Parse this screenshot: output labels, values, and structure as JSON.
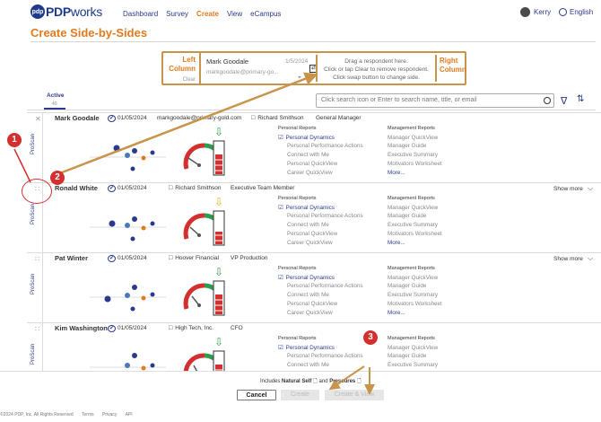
{
  "nav": {
    "logo_mark": "pdp",
    "logo_bold": "PDP",
    "logo_light": "works",
    "links": [
      "Dashboard",
      "Survey",
      "Create",
      "View",
      "eCampus"
    ],
    "active_link": "Create",
    "user": "Kerry",
    "language": "English"
  },
  "page": {
    "title": "Create Side-by-Sides"
  },
  "compare": {
    "left_label_1": "Left",
    "left_label_2": "Column",
    "left_clear": "Clear",
    "left_name": "Mark Goodale",
    "left_date": "1/5/2024",
    "left_email": "markgoodale@primary-go...",
    "mid_line1": "Drag a respondent here.",
    "mid_line2": "Click or tap Clear to remove respondent.",
    "mid_line3": "Click swap button to change side.",
    "right_label_1": "Right",
    "right_label_2": "Column"
  },
  "tabs": {
    "active_label": "Active",
    "active_count": "40"
  },
  "search": {
    "placeholder": "Click search icon or Enter to search name, title, or email"
  },
  "rows": [
    {
      "name": "Mark Goodale",
      "date": "01/05/2024",
      "email": "markgoodale@primary-gold.com",
      "company": "Richard Smithson",
      "title": "General Manager",
      "show_more": "",
      "side": "ProScan"
    },
    {
      "name": "Ronald White",
      "date": "01/05/2024",
      "email": "",
      "company": "Richard Smithson",
      "title": "Executive Team Member",
      "show_more": "Show more",
      "side": "ProScan"
    },
    {
      "name": "Pat Winter",
      "date": "01/05/2024",
      "email": "",
      "company": "Hoover Financial",
      "title": "VP Production",
      "show_more": "Show more",
      "side": "ProScan"
    },
    {
      "name": "Kim Washington",
      "date": "01/05/2024",
      "email": "",
      "company": "High Tech, Inc.",
      "title": "CFO",
      "show_more": "",
      "side": "ProScan"
    }
  ],
  "reports": {
    "personal_header": "Personal Reports",
    "personal": [
      "Personal Dynamics",
      "Personal Performance Actions",
      "Connect with Me",
      "Personal QuickView",
      "Career QuickView"
    ],
    "management_header": "Management Reports",
    "management": [
      "Manager QuickView",
      "Manager Guide",
      "Executive Summary",
      "Motivators Worksheet"
    ],
    "more": "More..."
  },
  "footer": {
    "includes_prefix": "Includes",
    "natural_self": "Natural Self",
    "and_text": "and",
    "pressures": "Pressures",
    "cancel": "Cancel",
    "create": "Create",
    "create_view": "Create & View",
    "copyright": "©2024 PDP, Inc. All Rights Reserved",
    "terms": "Terms",
    "privacy": "Privacy",
    "api": "API"
  },
  "annotations": {
    "one": "1",
    "two": "2",
    "three": "3"
  },
  "colors": {
    "brand": "#1e3a8a",
    "accent": "#e07a1f",
    "annotation": "#d32f2f",
    "arrow": "#c8934a"
  }
}
